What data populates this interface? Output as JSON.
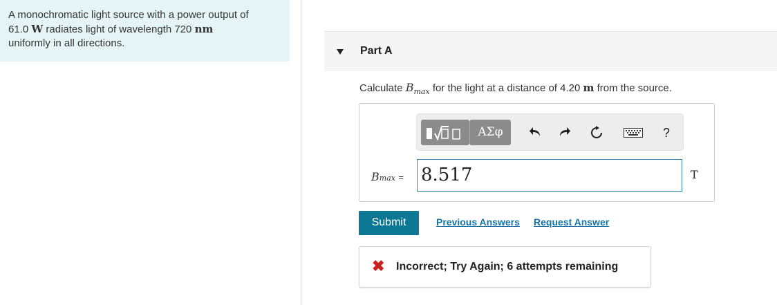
{
  "problem": {
    "text_line1": "A monochromatic light source with a power output of",
    "power_value": "61.0",
    "power_unit": "W",
    "text_line2_mid": "radiates light of wavelength 720",
    "wavelength_unit": "nm",
    "text_line3": "uniformly in all directions."
  },
  "part": {
    "title": "Part A"
  },
  "question": {
    "prefix": "Calculate",
    "symbol": "B",
    "symbol_sub": "max",
    "middle": "for the light at a distance of 4.20",
    "distance_unit": "m",
    "suffix": "from the source."
  },
  "toolbar": {
    "templates_icon": "templates-icon",
    "greek_label": "ΑΣφ",
    "undo_icon": "undo-icon",
    "redo_icon": "redo-icon",
    "reset_icon": "reset-icon",
    "keyboard_icon": "keyboard-icon",
    "help_label": "?"
  },
  "answer": {
    "label_symbol": "B",
    "label_sub": "max",
    "equals": "=",
    "value": "8.517",
    "unit": "T"
  },
  "actions": {
    "submit_label": "Submit",
    "previous_answers_label": "Previous Answers",
    "request_answer_label": "Request Answer"
  },
  "feedback": {
    "icon": "✖",
    "text": "Incorrect; Try Again; 6 attempts remaining"
  },
  "colors": {
    "problem_bg": "#e5f4f7",
    "submit_bg": "#0c7893",
    "link": "#1573a8",
    "error": "#cc1f1f",
    "input_border": "#2e84ad"
  }
}
